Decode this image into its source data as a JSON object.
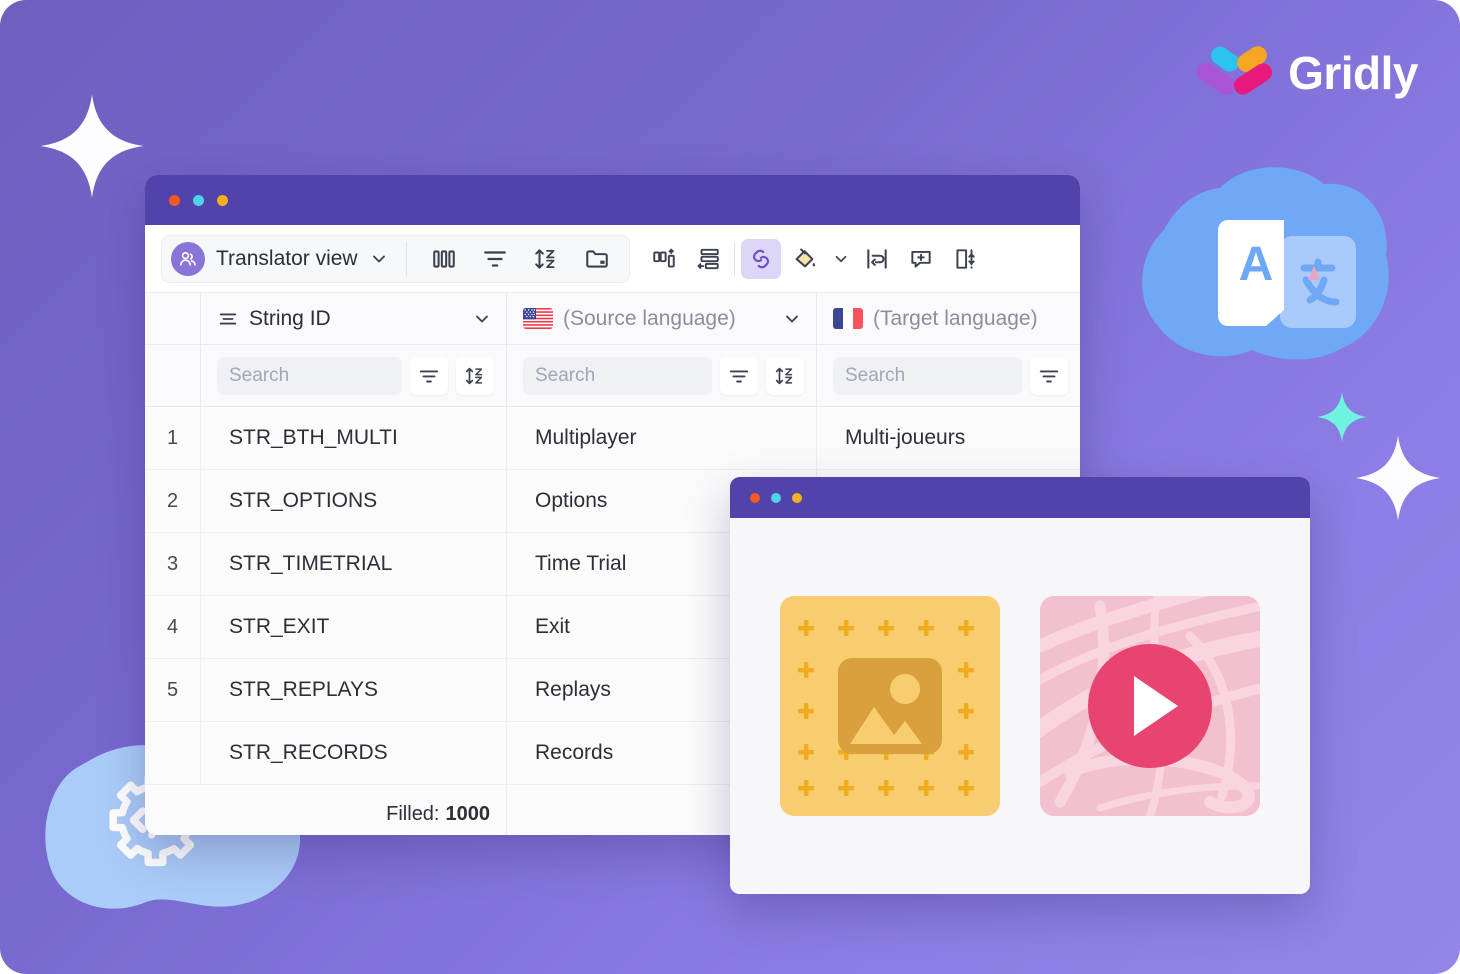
{
  "brand": {
    "name": "Gridly",
    "logo_colors": [
      "#2cc3f0",
      "#f5a623",
      "#a855d6",
      "#e8197d"
    ]
  },
  "theme": {
    "background_from": "#6f5fc0",
    "background_to": "#9287e8",
    "titlebar": "#5243aa",
    "accent": "#7a5cd6",
    "dot_red": "#f5591f",
    "dot_cyan": "#4cd3e8",
    "dot_yellow": "#f5b01f"
  },
  "decorations": {
    "sparkle_white_large": "sparkle-icon",
    "sparkle_white_small": "sparkle-icon",
    "sparkle_cyan": "sparkle-icon",
    "cloud_translate_color": "#6fa8f5",
    "cloud_code_color": "#aaccf8",
    "translate_icon": "translate-icon",
    "code_icon": "code-gear-icon"
  },
  "grid_window": {
    "traffic_lights": [
      "close",
      "minimize",
      "maximize"
    ],
    "toolbar": {
      "view_avatar_icon": "people-avatar-icon",
      "view_name": "Translator view",
      "view_dropdown_icon": "chevron-down-icon",
      "buttons": [
        {
          "name": "columns-icon",
          "label": "Columns"
        },
        {
          "name": "filter-icon",
          "label": "Filter"
        },
        {
          "name": "sort-az-icon",
          "label": "Sort"
        },
        {
          "name": "folder-icon",
          "label": "Folder"
        },
        {
          "name": "group-columns-icon",
          "label": "Group columns"
        },
        {
          "name": "row-height-icon",
          "label": "Row height"
        },
        {
          "name": "dependency-link-icon",
          "label": "Dependencies"
        },
        {
          "name": "paint-bucket-icon",
          "label": "Fill color"
        },
        {
          "name": "paint-bucket-dropdown-icon",
          "label": "Fill color options"
        },
        {
          "name": "wrap-text-icon",
          "label": "Wrap text"
        },
        {
          "name": "add-comment-icon",
          "label": "Add comment"
        },
        {
          "name": "resize-record-icon",
          "label": "Record height"
        }
      ]
    },
    "columns": [
      {
        "id": "string-id",
        "title": "String ID",
        "icon": "text-lines-icon",
        "has_dropdown": true,
        "search_placeholder": "Search",
        "actions": [
          "filter-icon",
          "sort-az-icon"
        ]
      },
      {
        "id": "source-language",
        "title": "(Source language)",
        "icon": "flag-us-icon",
        "has_dropdown": true,
        "search_placeholder": "Search",
        "actions": [
          "filter-icon",
          "sort-az-icon"
        ]
      },
      {
        "id": "target-language",
        "title": "(Target language)",
        "icon": "flag-fr-icon",
        "has_dropdown": false,
        "search_placeholder": "Search",
        "actions": [
          "filter-icon"
        ]
      }
    ],
    "rows": [
      {
        "num": "1",
        "string_id": "STR_BTH_MULTI",
        "source": "Multiplayer",
        "target": "Multi-joueurs"
      },
      {
        "num": "2",
        "string_id": "STR_OPTIONS",
        "source": "Options",
        "target": ""
      },
      {
        "num": "3",
        "string_id": "STR_TIMETRIAL",
        "source": "Time Trial",
        "target": ""
      },
      {
        "num": "4",
        "string_id": "STR_EXIT",
        "source": "Exit",
        "target": ""
      },
      {
        "num": "5",
        "string_id": "STR_REPLAYS",
        "source": "Replays",
        "target": ""
      },
      {
        "num": "",
        "string_id": "STR_RECORDS",
        "source": "Records",
        "target": ""
      }
    ],
    "footer": {
      "label": "Filled:",
      "value": "1000"
    }
  },
  "media_window": {
    "traffic_lights": [
      "close",
      "minimize",
      "maximize"
    ],
    "tiles": [
      {
        "type": "image",
        "icon": "image-placeholder-icon",
        "bg": "#f8cd70",
        "accent": "#dba03e"
      },
      {
        "type": "video",
        "icon": "play-button-icon",
        "bg": "#f3c0cd",
        "accent": "#e8446f"
      }
    ]
  }
}
